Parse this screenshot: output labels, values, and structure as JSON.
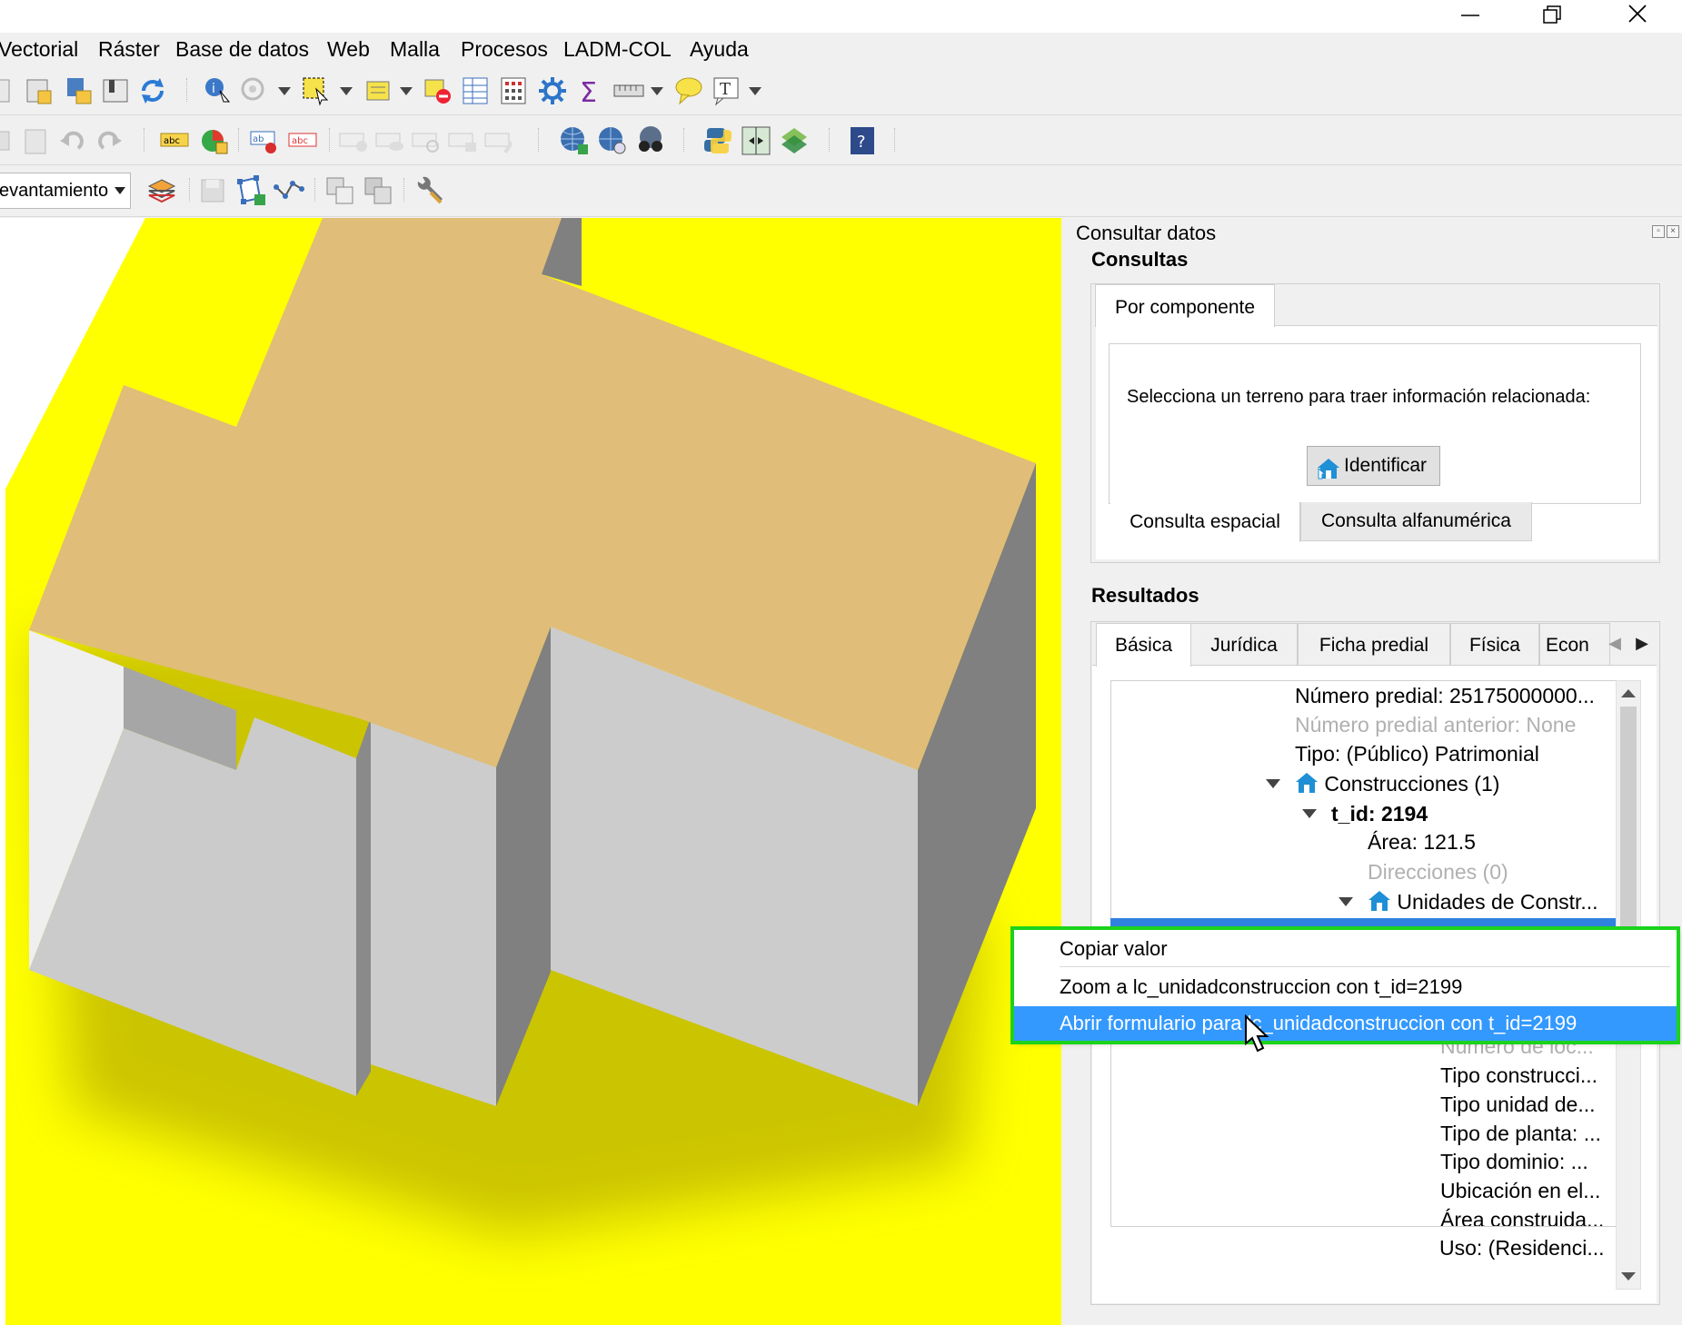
{
  "menubar": {
    "items": [
      "Vectorial",
      "Ráster",
      "Base de datos",
      "Web",
      "Malla",
      "Procesos",
      "LADM-COL",
      "Ayuda"
    ]
  },
  "window_controls": {
    "minimize": "minimize-icon",
    "restore": "restore-icon",
    "close": "close-icon"
  },
  "toolbar3": {
    "layer_combo": "evantamiento"
  },
  "dock": {
    "title": "Consultar datos",
    "consultas": {
      "label": "Consultas",
      "tab": "Por componente",
      "message": "Selecciona un terreno para traer información relacionada:",
      "identify_button": "Identificar",
      "bottom_tabs": [
        "Consulta espacial",
        "Consulta alfanumérica"
      ]
    },
    "resultados": {
      "label": "Resultados",
      "tabs": [
        "Básica",
        "Jurídica",
        "Ficha predial",
        "Física",
        "Econ"
      ],
      "tree": {
        "numero_predial": "Número predial: 25175000000...",
        "numero_predial_anterior": "Número predial anterior: None",
        "tipo": "Tipo: (Público) Patrimonial",
        "construcciones": "Construcciones (1)",
        "t_id": "t_id: 2194",
        "area": "Área: 121.5",
        "direcciones": "Direcciones (0)",
        "unidades": "Unidades de Constr...",
        "numero_loc": "Número de loc...",
        "tipo_construccion": "Tipo construcci...",
        "tipo_unidad": "Tipo unidad de...",
        "tipo_planta": "Tipo de planta: ...",
        "tipo_dominio": "Tipo dominio: ...",
        "ubicacion": "Ubicación en el...",
        "area_construida": "Área construida...",
        "uso": "Uso: (Residenci..."
      }
    }
  },
  "context_menu": {
    "items": [
      "Copiar valor",
      "Zoom a lc_unidadconstruccion con t_id=2199",
      "Abrir formulario para lc_unidadconstruccion con t_id=2199"
    ],
    "highlighted_index": 2,
    "highlight_color": "#3399ff",
    "annotation_border_color": "#1bd31b"
  },
  "map": {
    "background_color": "#ffff00",
    "roof_color": "#e0bd78",
    "wall_light_color": "#cccccc",
    "wall_dark_color": "#808080"
  }
}
